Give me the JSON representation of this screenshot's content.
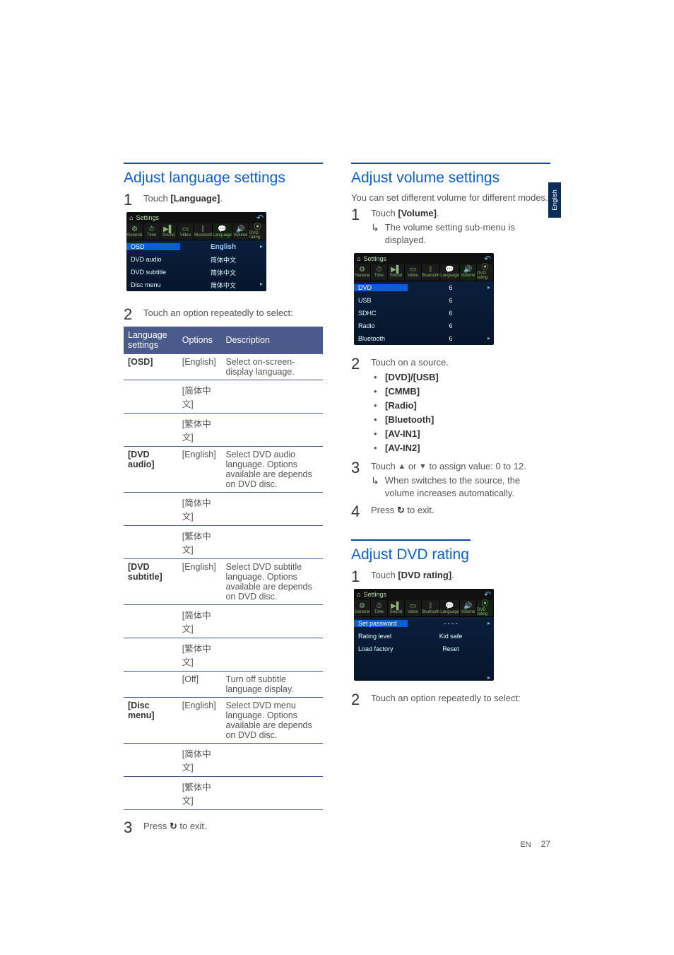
{
  "sideTab": "English",
  "left": {
    "heading": "Adjust language settings",
    "step1": {
      "num": "1",
      "pre": "Touch ",
      "bold": "[Language]",
      "post": "."
    },
    "shot": {
      "title": "Settings",
      "rows": [
        {
          "left": "OSD",
          "right": "English",
          "hl": true,
          "eng": true,
          "chev": true
        },
        {
          "left": "DVD audio",
          "right": "简体中文"
        },
        {
          "left": "DVD subtitle",
          "right": "简体中文"
        },
        {
          "left": "Disc menu",
          "right": "简体中文",
          "chev": true
        }
      ]
    },
    "step2": {
      "num": "2",
      "text": "Touch an option repeatedly to select:"
    },
    "table": {
      "headers": [
        "Language settings",
        "Options",
        "Description"
      ],
      "groups": [
        {
          "setting": "[OSD]",
          "rows": [
            {
              "opt": "[English]",
              "desc": "Select on-screen-display language."
            },
            {
              "opt": "[简体中文]",
              "desc": "",
              "cjk": true
            },
            {
              "opt": "[繁体中文]",
              "desc": "",
              "cjk": true
            }
          ]
        },
        {
          "setting": "[DVD audio]",
          "rows": [
            {
              "opt": "[English]",
              "desc": "Select DVD audio language. Options available are depends on DVD disc."
            },
            {
              "opt": "[简体中文]",
              "desc": "",
              "cjk": true
            },
            {
              "opt": "[繁体中文]",
              "desc": "",
              "cjk": true
            }
          ]
        },
        {
          "setting": "[DVD subtitle]",
          "rows": [
            {
              "opt": "[English]",
              "desc": "Select DVD subtitle language. Options available are depends on DVD disc."
            },
            {
              "opt": "[简体中文]",
              "desc": "",
              "cjk": true
            },
            {
              "opt": "[繁体中文]",
              "desc": "",
              "cjk": true
            },
            {
              "opt": "[Off]",
              "desc": "Turn off subtitle language display.",
              "blue": true
            }
          ]
        },
        {
          "setting": "[Disc menu]",
          "rows": [
            {
              "opt": "[English]",
              "desc": "Select DVD menu language. Options available are depends on DVD disc."
            },
            {
              "opt": "[简体中文]",
              "desc": "",
              "cjk": true
            },
            {
              "opt": "[繁体中文]",
              "desc": "",
              "cjk": true
            }
          ]
        }
      ]
    },
    "step3": {
      "num": "3",
      "pre": "Press ",
      "icon": "↺",
      "post": " to exit."
    }
  },
  "right": {
    "volume": {
      "heading": "Adjust volume settings",
      "intro": "You can set different volume for different modes.",
      "step1": {
        "num": "1",
        "pre": "Touch ",
        "bold": "[Volume]",
        "post": "."
      },
      "step1sub": "The volume setting sub-menu is displayed.",
      "shot": {
        "title": "Settings",
        "rows": [
          {
            "left": "DVD",
            "right": "6",
            "hl": true,
            "chev": true
          },
          {
            "left": "USB",
            "right": "6"
          },
          {
            "left": "SDHC",
            "right": "6"
          },
          {
            "left": "Radio",
            "right": "6"
          },
          {
            "left": "Bluetooth",
            "right": "6",
            "chev": true
          }
        ]
      },
      "step2": {
        "num": "2",
        "text": "Touch on a source."
      },
      "sources": [
        "[DVD]/[USB]",
        "[CMMB]",
        "[Radio]",
        "[Bluetooth]",
        "[AV-IN1]",
        "[AV-IN2]"
      ],
      "step3": {
        "num": "3",
        "pre": "Touch ",
        "mid": " or ",
        "post": " to assign value: 0 to 12."
      },
      "step3sub": "When switches to the source, the volume increases automatically.",
      "step4": {
        "num": "4",
        "pre": "Press ",
        "icon": "↺",
        "post": " to exit."
      }
    },
    "dvd": {
      "heading": "Adjust DVD rating",
      "step1": {
        "num": "1",
        "pre": "Touch ",
        "bold": "[DVD rating]",
        "post": "."
      },
      "shot": {
        "title": "Settings",
        "rows": [
          {
            "left": "Set password",
            "right": "- - - -",
            "hl": true,
            "chev": true
          },
          {
            "left": "Rating level",
            "right": "Kid safe"
          },
          {
            "left": "Load factory",
            "right": "Reset"
          },
          {
            "left": "",
            "right": ""
          },
          {
            "left": "",
            "right": "",
            "chev": true
          }
        ]
      },
      "step2": {
        "num": "2",
        "text": "Touch an option repeatedly to select:"
      }
    }
  },
  "tabs": [
    {
      "icn": "⚙",
      "lbl": "General"
    },
    {
      "icn": "⏱",
      "lbl": "Time"
    },
    {
      "icn": "▶▌",
      "lbl": "Sound"
    },
    {
      "icn": "▭",
      "lbl": "Video"
    },
    {
      "icn": "ᛒ",
      "lbl": "Bluetooth"
    },
    {
      "icn": "💬",
      "lbl": "Language"
    },
    {
      "icn": "🔊",
      "lbl": "Volume"
    },
    {
      "icn": "⦿",
      "lbl": "DVD rating"
    }
  ],
  "footer": {
    "label": "EN",
    "page": "27"
  }
}
